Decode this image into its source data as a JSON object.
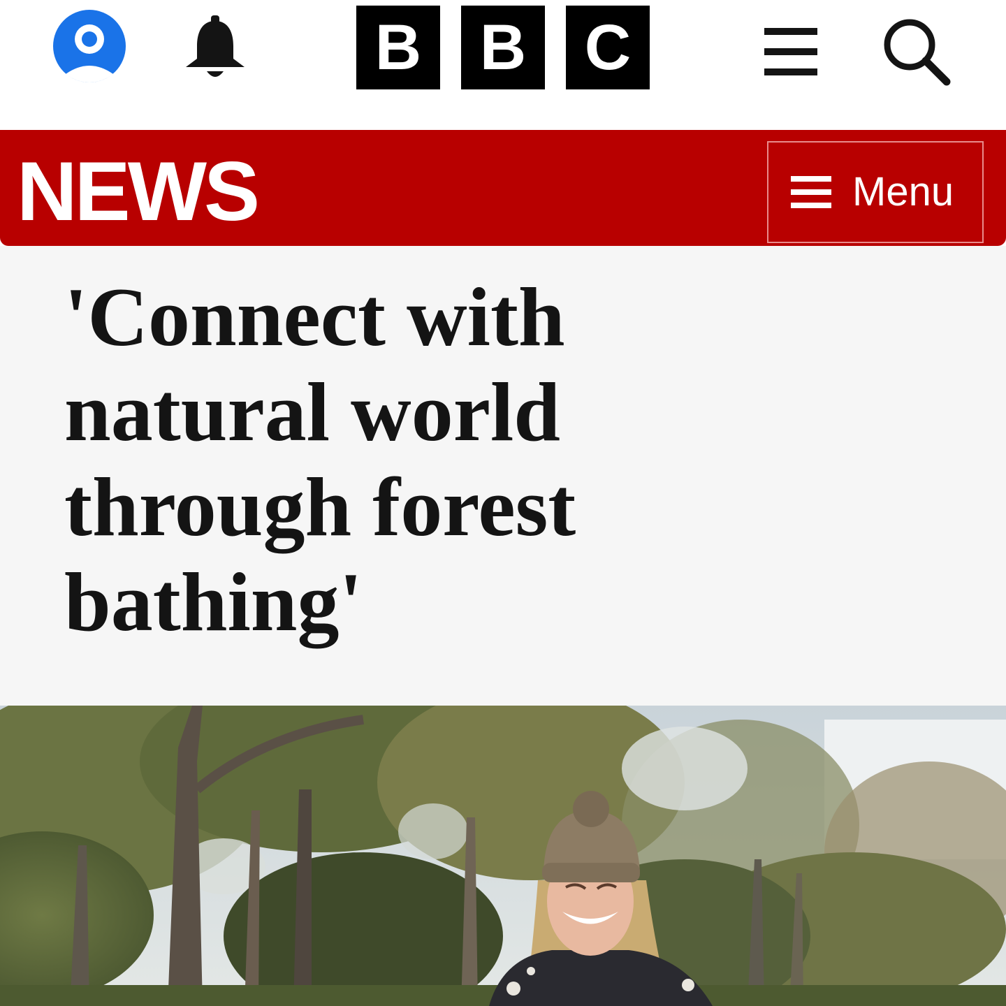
{
  "header": {
    "logo_letters": [
      "B",
      "B",
      "C"
    ],
    "icons": {
      "account": "account-icon",
      "notifications": "bell-icon",
      "menu": "hamburger-icon",
      "search": "search-icon"
    },
    "colors": {
      "account_blue": "#1a73e8",
      "logo_black": "#000000"
    }
  },
  "newsbar": {
    "wordmark": "NEWS",
    "menu_label": "Menu",
    "colors": {
      "background": "#b80000",
      "text": "#ffffff"
    }
  },
  "article": {
    "headline": "'Connect with natural world through forest bathing'",
    "image": "woman-in-beanie-smiling-in-forest-photo"
  }
}
